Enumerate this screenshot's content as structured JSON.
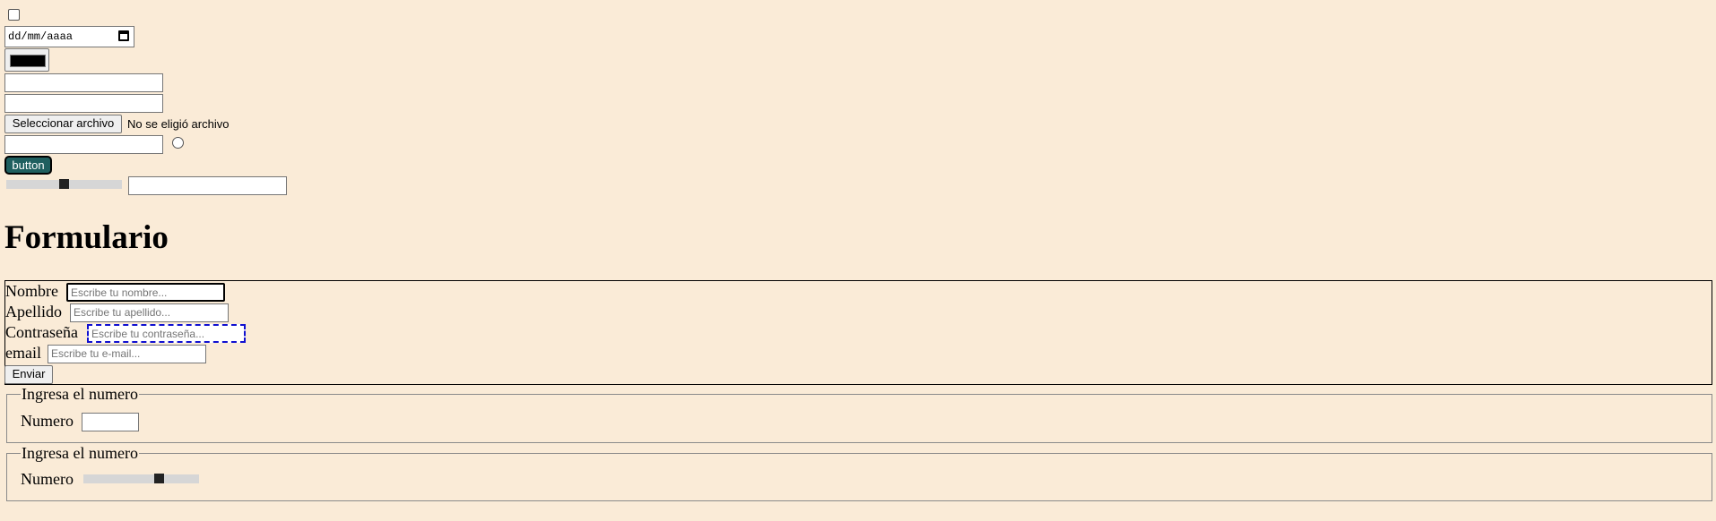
{
  "date_input": {
    "placeholder": "dd/mm/aaaa"
  },
  "color_input": {
    "value": "#000000"
  },
  "file_input": {
    "button_label": "Seleccionar archivo",
    "status": "No se eligió archivo"
  },
  "custom_button": {
    "label": "button"
  },
  "range_top": {
    "value": 50
  },
  "page_title": "Formulario",
  "form": {
    "nombre": {
      "label": "Nombre",
      "placeholder": "Escribe tu nombre..."
    },
    "apellido": {
      "label": "Apellido",
      "placeholder": "Escribe tu apellido..."
    },
    "contrasena": {
      "label": "Contraseña",
      "placeholder": "Escribe tu contraseña..."
    },
    "email": {
      "label": "email",
      "placeholder": "Escribe tu e-mail..."
    },
    "submit_label": "Enviar"
  },
  "fieldset_number": {
    "legend": "Ingresa el numero",
    "label": "Numero"
  },
  "fieldset_range": {
    "legend": "Ingresa el numero",
    "label": "Numero",
    "value": 65
  },
  "colors": {
    "background": "#faebd7",
    "button_accent": "#1f5f5f"
  }
}
